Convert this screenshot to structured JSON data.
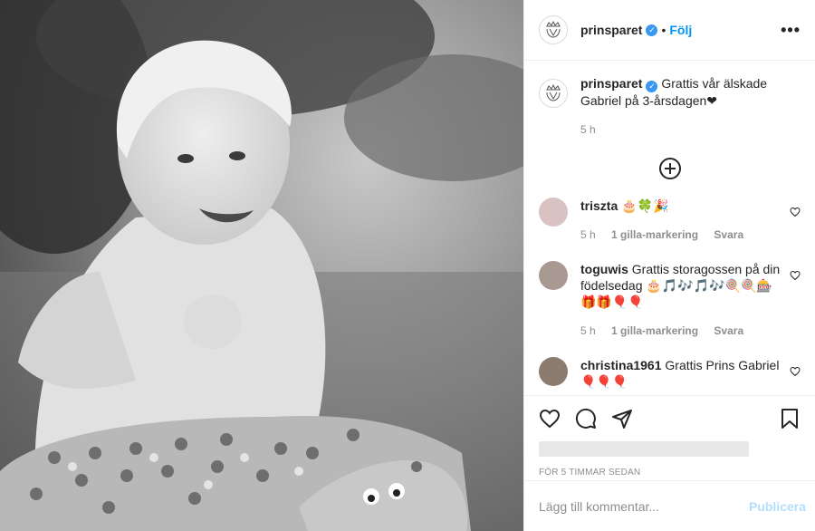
{
  "header": {
    "username": "prinsparet",
    "verified_icon": "verified-badge-icon",
    "dot": "•",
    "follow_label": "Följ",
    "more_label": "•••"
  },
  "caption": {
    "username": "prinsparet",
    "text": "Grattis vår älskade Gabriel på 3-årsdagen❤",
    "time": "5 h"
  },
  "comments": [
    {
      "username": "triszta",
      "text": "🎂🍀🎉",
      "time": "5 h",
      "likes": "1 gilla-markering",
      "reply": "Svara"
    },
    {
      "username": "toguwis",
      "text": "Grattis storagossen på din födelsedag 🎂🎵🎶🎵🎶🍭🍭🎰🎁🎁🎈🎈",
      "time": "5 h",
      "likes": "1 gilla-markering",
      "reply": "Svara"
    },
    {
      "username": "christina1961",
      "text": "Grattis Prins Gabriel 🎈🎈🎈"
    }
  ],
  "footer": {
    "time_ago": "FÖR 5 TIMMAR SEDAN",
    "comment_placeholder": "Lägg till kommentar...",
    "publish_label": "Publicera"
  },
  "colors": {
    "accent": "#0095f6",
    "publish_disabled": "#b2dffc",
    "muted": "#8e8e8e"
  }
}
